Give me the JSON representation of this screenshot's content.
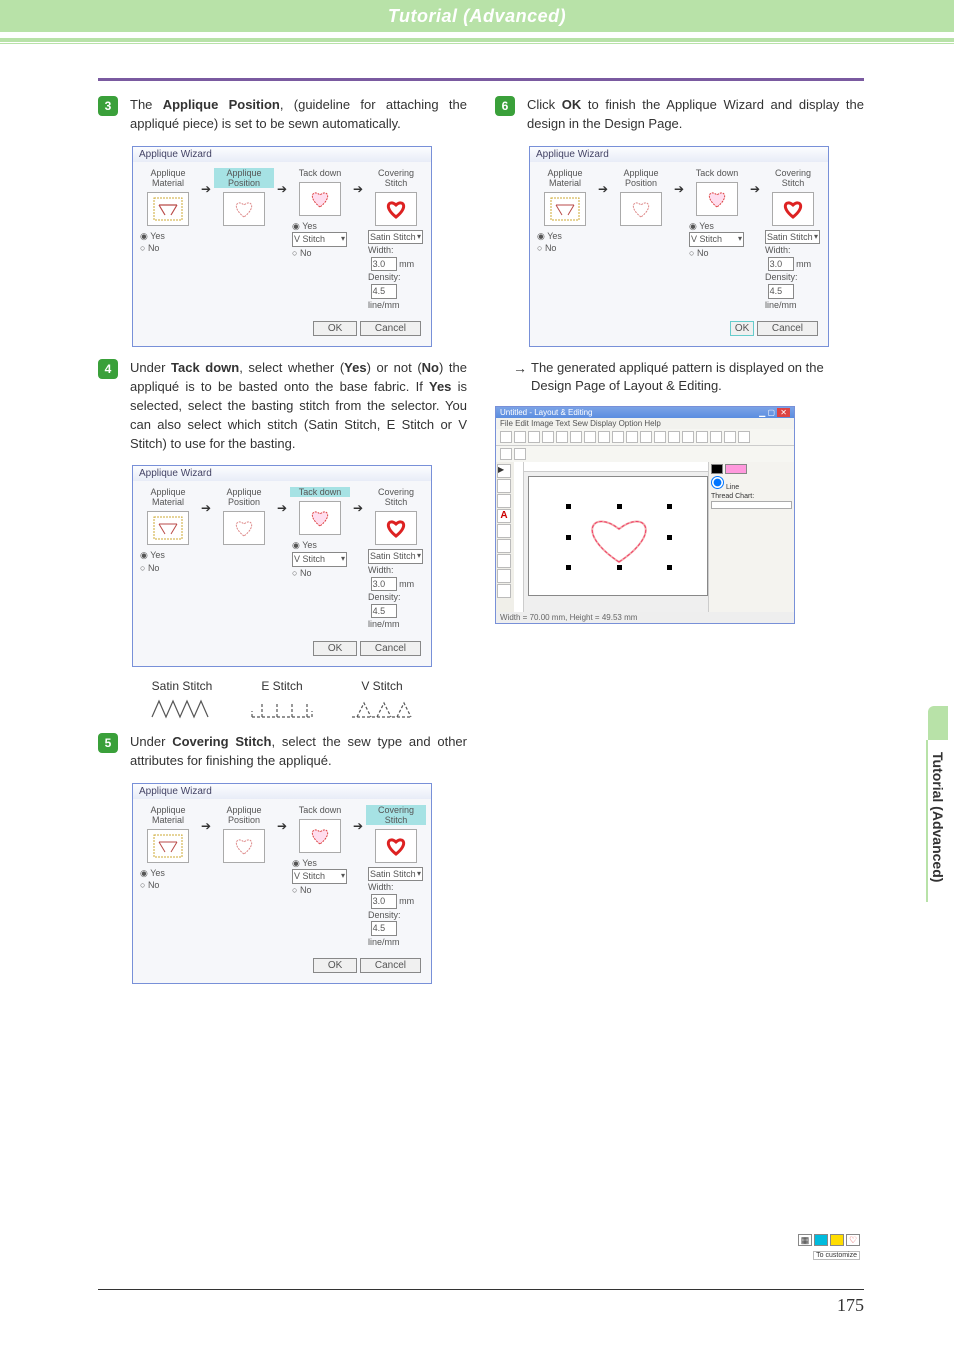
{
  "header": {
    "title": "Tutorial (Advanced)"
  },
  "side_tab": "Tutorial (Advanced)",
  "page_number": "175",
  "steps": {
    "s3": {
      "num": "3",
      "text_a": "The ",
      "bold_a": "Applique Position",
      "text_b": ", (guideline for attaching the appliqué piece) is set to be sewn automatically."
    },
    "s4": {
      "num": "4",
      "text_a": "Under ",
      "bold_a": "Tack down",
      "text_b": ", select whether (",
      "bold_b": "Yes",
      "text_c": ") or not (",
      "bold_c": "No",
      "text_d": ") the appliqué is to be basted onto the base fabric. If ",
      "bold_d": "Yes",
      "text_e": " is selected, select the basting stitch from the selector. You can also select which stitch (Satin Stitch, E Stitch or V Stitch) to use for the basting."
    },
    "s5": {
      "num": "5",
      "text_a": "Under ",
      "bold_a": "Covering Stitch",
      "text_b": ", select the sew type and other attributes for finishing the appliqué."
    },
    "s6": {
      "num": "6",
      "text_a": "Click ",
      "bold_a": "OK",
      "text_b": " to finish the Applique Wizard and display the design in the Design Page."
    }
  },
  "stitch_labels": {
    "satin": "Satin Stitch",
    "e": "E Stitch",
    "v": "V Stitch"
  },
  "note_after_6": {
    "arrow": "→",
    "text": "The generated appliqué pattern is displayed on the Design Page of Layout & Editing."
  },
  "wizard": {
    "title": "Applique Wizard",
    "col1": "Applique Material",
    "col2": "Applique Position",
    "col3": "Tack down",
    "col4": "Covering Stitch",
    "yes": "Yes",
    "no": "No",
    "vstitch": "V Stitch",
    "satin_stitch": "Satin Stitch",
    "width_lbl": "Width:",
    "width_val": "3.0",
    "mm": "mm",
    "density_lbl": "Density:",
    "density_val": "4.5",
    "lmm": "line/mm",
    "ok": "OK",
    "cancel": "Cancel"
  },
  "app": {
    "title": "Untitled - Layout & Editing",
    "menus": "File  Edit  Image  Text  Sew  Display  Option  Help",
    "status": "Width = 70.00 mm, Height = 49.53 mm",
    "tab": "To customize",
    "line_lbl": "Line",
    "thread_lbl": "Thread Chart:"
  }
}
